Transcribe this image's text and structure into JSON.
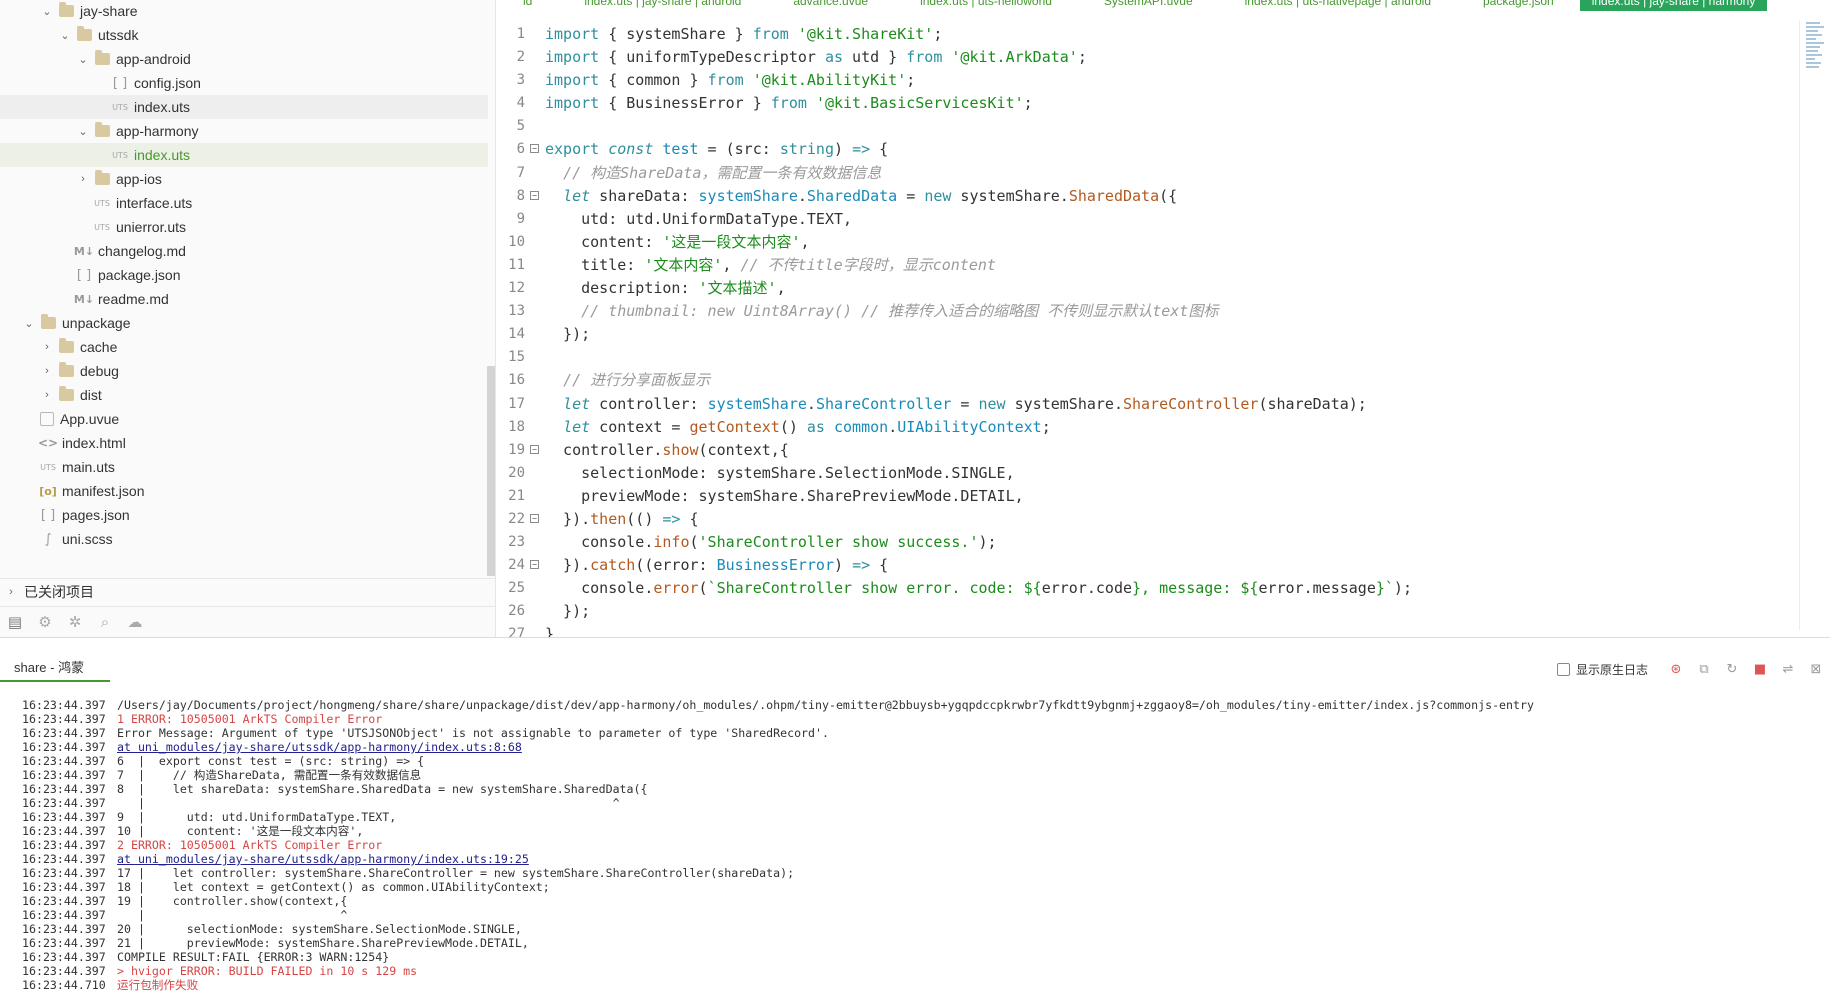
{
  "sidebar": {
    "tree": [
      {
        "label": "jay-share",
        "depth": 2,
        "type": "folder",
        "arrow": "down",
        "state": ""
      },
      {
        "label": "utssdk",
        "depth": 3,
        "type": "folder",
        "arrow": "down",
        "state": ""
      },
      {
        "label": "app-android",
        "depth": 4,
        "type": "folder",
        "arrow": "down",
        "state": ""
      },
      {
        "label": "config.json",
        "depth": 5,
        "type": "json",
        "arrow": "none",
        "state": ""
      },
      {
        "label": "index.uts",
        "depth": 5,
        "type": "uts",
        "arrow": "none",
        "state": "selected"
      },
      {
        "label": "app-harmony",
        "depth": 4,
        "type": "folder",
        "arrow": "down",
        "state": ""
      },
      {
        "label": "index.uts",
        "depth": 5,
        "type": "uts",
        "arrow": "none",
        "state": "selected-green"
      },
      {
        "label": "app-ios",
        "depth": 4,
        "type": "folder",
        "arrow": "right",
        "state": ""
      },
      {
        "label": "interface.uts",
        "depth": 4,
        "type": "uts",
        "arrow": "none",
        "state": ""
      },
      {
        "label": "unierror.uts",
        "depth": 4,
        "type": "uts",
        "arrow": "none",
        "state": ""
      },
      {
        "label": "changelog.md",
        "depth": 3,
        "type": "md",
        "arrow": "none",
        "state": ""
      },
      {
        "label": "package.json",
        "depth": 3,
        "type": "json",
        "arrow": "none",
        "state": ""
      },
      {
        "label": "readme.md",
        "depth": 3,
        "type": "md",
        "arrow": "none",
        "state": ""
      },
      {
        "label": "unpackage",
        "depth": 1,
        "type": "folder",
        "arrow": "down",
        "state": ""
      },
      {
        "label": "cache",
        "depth": 2,
        "type": "folder",
        "arrow": "right",
        "state": ""
      },
      {
        "label": "debug",
        "depth": 2,
        "type": "folder",
        "arrow": "right",
        "state": ""
      },
      {
        "label": "dist",
        "depth": 2,
        "type": "folder",
        "arrow": "right",
        "state": ""
      },
      {
        "label": "App.uvue",
        "depth": 1,
        "type": "vue",
        "arrow": "none",
        "state": ""
      },
      {
        "label": "index.html",
        "depth": 1,
        "type": "html",
        "arrow": "none",
        "state": ""
      },
      {
        "label": "main.uts",
        "depth": 1,
        "type": "uts",
        "arrow": "none",
        "state": ""
      },
      {
        "label": "manifest.json",
        "depth": 1,
        "type": "manifest",
        "arrow": "none",
        "state": ""
      },
      {
        "label": "pages.json",
        "depth": 1,
        "type": "json",
        "arrow": "none",
        "state": ""
      },
      {
        "label": "uni.scss",
        "depth": 1,
        "type": "scss",
        "arrow": "none",
        "state": ""
      }
    ],
    "closed_projects": "已关闭项目",
    "toolbar_icons": [
      "project-manager-icon",
      "plugin-icon",
      "bug-icon",
      "search-icon",
      "cloud-icon"
    ]
  },
  "editor": {
    "tabs": [
      {
        "label": "ld",
        "active": false
      },
      {
        "label": "index.uts | jay-share | android",
        "active": false
      },
      {
        "label": "advance.uvue",
        "active": false
      },
      {
        "label": "index.uts | uts-helloworld",
        "active": false
      },
      {
        "label": "SystemAPI.uvue",
        "active": false
      },
      {
        "label": "index.uts | uts-nativepage | android",
        "active": false
      },
      {
        "label": "package.json",
        "active": false
      },
      {
        "label": "index.uts | jay-share | harmony",
        "active": true
      }
    ],
    "lines": [
      {
        "n": "1",
        "fold": "",
        "html": "<span class=\"kw\">import</span> { systemShare } <span class=\"kw\">from</span> <span class=\"str\">'@kit.ShareKit'</span>;"
      },
      {
        "n": "2",
        "fold": "",
        "html": "<span class=\"kw\">import</span> { uniformTypeDescriptor <span class=\"kw\">as</span> utd } <span class=\"kw\">from</span> <span class=\"str\">'@kit.ArkData'</span>;"
      },
      {
        "n": "3",
        "fold": "",
        "html": "<span class=\"kw\">import</span> { common } <span class=\"kw\">from</span> <span class=\"str\">'@kit.AbilityKit'</span>;"
      },
      {
        "n": "4",
        "fold": "",
        "html": "<span class=\"kw\">import</span> { BusinessError } <span class=\"kw\">from</span> <span class=\"str\">'@kit.BasicServicesKit'</span>;"
      },
      {
        "n": "5",
        "fold": "",
        "html": ""
      },
      {
        "n": "6",
        "fold": "⊟",
        "html": "<span class=\"kw\">export</span> <span class=\"kwi\">const</span> <span class=\"ty\">test</span> = (src: <span class=\"kw\">string</span>) <span class=\"kw\">=></span> {"
      },
      {
        "n": "7",
        "fold": "",
        "html": "  <span class=\"cmt\">// 构造ShareData，需配置一条有效数据信息</span>"
      },
      {
        "n": "8",
        "fold": "⊟",
        "html": "  <span class=\"kwi\">let</span> shareData: <span class=\"ty\">systemShare</span>.<span class=\"ty\">SharedData</span> = <span class=\"kw\">new</span> systemShare.<span class=\"fn\">SharedData</span>({"
      },
      {
        "n": "9",
        "fold": "",
        "html": "    utd: utd.UniformDataType.TEXT,"
      },
      {
        "n": "10",
        "fold": "",
        "html": "    content: <span class=\"str\">'这是一段文本内容'</span>,"
      },
      {
        "n": "11",
        "fold": "",
        "html": "    title: <span class=\"str\">'文本内容'</span>, <span class=\"cmt\">// 不传title字段时，显示content</span>"
      },
      {
        "n": "12",
        "fold": "",
        "html": "    description: <span class=\"str\">'文本描述'</span>,"
      },
      {
        "n": "13",
        "fold": "",
        "html": "    <span class=\"cmt\">// thumbnail: new Uint8Array() // 推荐传入适合的缩略图 不传则显示默认text图标</span>"
      },
      {
        "n": "14",
        "fold": "",
        "html": "  });"
      },
      {
        "n": "15",
        "fold": "",
        "html": ""
      },
      {
        "n": "16",
        "fold": "",
        "html": "  <span class=\"cmt\">// 进行分享面板显示</span>"
      },
      {
        "n": "17",
        "fold": "",
        "html": "  <span class=\"kwi\">let</span> controller: <span class=\"ty\">systemShare</span>.<span class=\"ty\">ShareController</span> = <span class=\"kw\">new</span> systemShare.<span class=\"fn\">ShareController</span>(shareData);"
      },
      {
        "n": "18",
        "fold": "",
        "html": "  <span class=\"kwi\">let</span> context = <span class=\"fn\">getContext</span>() <span class=\"kw\">as</span> <span class=\"ty\">common</span>.<span class=\"ty\">UIAbilityContext</span>;"
      },
      {
        "n": "19",
        "fold": "⊟",
        "html": "  controller.<span class=\"fn\">show</span>(context,{"
      },
      {
        "n": "20",
        "fold": "",
        "html": "    selectionMode: systemShare.SelectionMode.SINGLE,"
      },
      {
        "n": "21",
        "fold": "",
        "html": "    previewMode: systemShare.SharePreviewMode.DETAIL,"
      },
      {
        "n": "22",
        "fold": "⊟",
        "html": "  }).<span class=\"fn\">then</span>(() <span class=\"kw\">=></span> {"
      },
      {
        "n": "23",
        "fold": "",
        "html": "    console.<span class=\"fn\">info</span>(<span class=\"str\">'ShareController show success.'</span>);"
      },
      {
        "n": "24",
        "fold": "⊟",
        "html": "  }).<span class=\"fn\">catch</span>((error: <span class=\"ty\">BusinessError</span>) <span class=\"kw\">=></span> {"
      },
      {
        "n": "25",
        "fold": "",
        "html": "    console.<span class=\"fn\">error</span>(<span class=\"str\">`ShareController show error. code: ${</span>error.code<span class=\"str\">}, message: ${</span>error.message<span class=\"str\">}`</span>);"
      },
      {
        "n": "26",
        "fold": "",
        "html": "  });"
      },
      {
        "n": "27",
        "fold": "",
        "html": "}"
      }
    ]
  },
  "console": {
    "tab_label": "share - 鸿蒙",
    "native_log_label": "显示原生日志",
    "tool_icons": [
      "stop-icon",
      "copy-icon",
      "refresh-icon",
      "clear-icon",
      "wrap-icon",
      "close-panel-icon"
    ],
    "lines": [
      {
        "ts": "16:23:44.397",
        "msg": "/Users/jay/Documents/project/hongmeng/share/share/unpackage/dist/dev/app-harmony/oh_modules/.ohpm/tiny-emitter@2bbuysb+ygqpdccpkrwbr7yfkdtt9ybgnmj+zggaoy8=/oh_modules/tiny-emitter/index.js?commonjs-entry",
        "kind": ""
      },
      {
        "ts": "16:23:44.397",
        "msg": "1 ERROR: 10505001 ArkTS Compiler Error",
        "kind": "err"
      },
      {
        "ts": "16:23:44.397",
        "msg": "Error Message: Argument of type 'UTSJSONObject' is not assignable to parameter of type 'SharedRecord'.",
        "kind": ""
      },
      {
        "ts": "16:23:44.397",
        "msg": "at uni_modules/jay-share/utssdk/app-harmony/index.uts:8:68",
        "kind": "link"
      },
      {
        "ts": "16:23:44.397",
        "msg": "6  |  export const test = (src: string) => {",
        "kind": ""
      },
      {
        "ts": "16:23:44.397",
        "msg": "7  |    // 构造ShareData, 需配置一条有效数据信息",
        "kind": ""
      },
      {
        "ts": "16:23:44.397",
        "msg": "8  |    let shareData: systemShare.SharedData = new systemShare.SharedData({",
        "kind": ""
      },
      {
        "ts": "16:23:44.397",
        "msg": "   |                                                                   ^",
        "kind": ""
      },
      {
        "ts": "16:23:44.397",
        "msg": "9  |      utd: utd.UniformDataType.TEXT,",
        "kind": ""
      },
      {
        "ts": "16:23:44.397",
        "msg": "10 |      content: '这是一段文本内容',",
        "kind": ""
      },
      {
        "ts": "16:23:44.397",
        "msg": "2 ERROR: 10505001 ArkTS Compiler Error",
        "kind": "err"
      },
      {
        "ts": "16:23:44.397",
        "msg": "at uni_modules/jay-share/utssdk/app-harmony/index.uts:19:25",
        "kind": "link"
      },
      {
        "ts": "16:23:44.397",
        "msg": "17 |    let controller: systemShare.ShareController = new systemShare.ShareController(shareData);",
        "kind": ""
      },
      {
        "ts": "16:23:44.397",
        "msg": "18 |    let context = getContext() as common.UIAbilityContext;",
        "kind": ""
      },
      {
        "ts": "16:23:44.397",
        "msg": "19 |    controller.show(context,{",
        "kind": ""
      },
      {
        "ts": "16:23:44.397",
        "msg": "   |                            ^",
        "kind": ""
      },
      {
        "ts": "16:23:44.397",
        "msg": "20 |      selectionMode: systemShare.SelectionMode.SINGLE,",
        "kind": ""
      },
      {
        "ts": "16:23:44.397",
        "msg": "21 |      previewMode: systemShare.SharePreviewMode.DETAIL,",
        "kind": ""
      },
      {
        "ts": "16:23:44.397",
        "msg": "COMPILE RESULT:FAIL {ERROR:3 WARN:1254}",
        "kind": ""
      },
      {
        "ts": "16:23:44.397",
        "msg": "> hvigor ERROR: BUILD FAILED in 10 s 129 ms",
        "kind": "err"
      },
      {
        "ts": "16:23:44.710",
        "msg": "运行包制作失败",
        "kind": "err"
      }
    ]
  },
  "colors": {
    "accent": "#46992f",
    "active_tab": "#2aa35b",
    "error": "#d64545",
    "link": "#22228e"
  }
}
